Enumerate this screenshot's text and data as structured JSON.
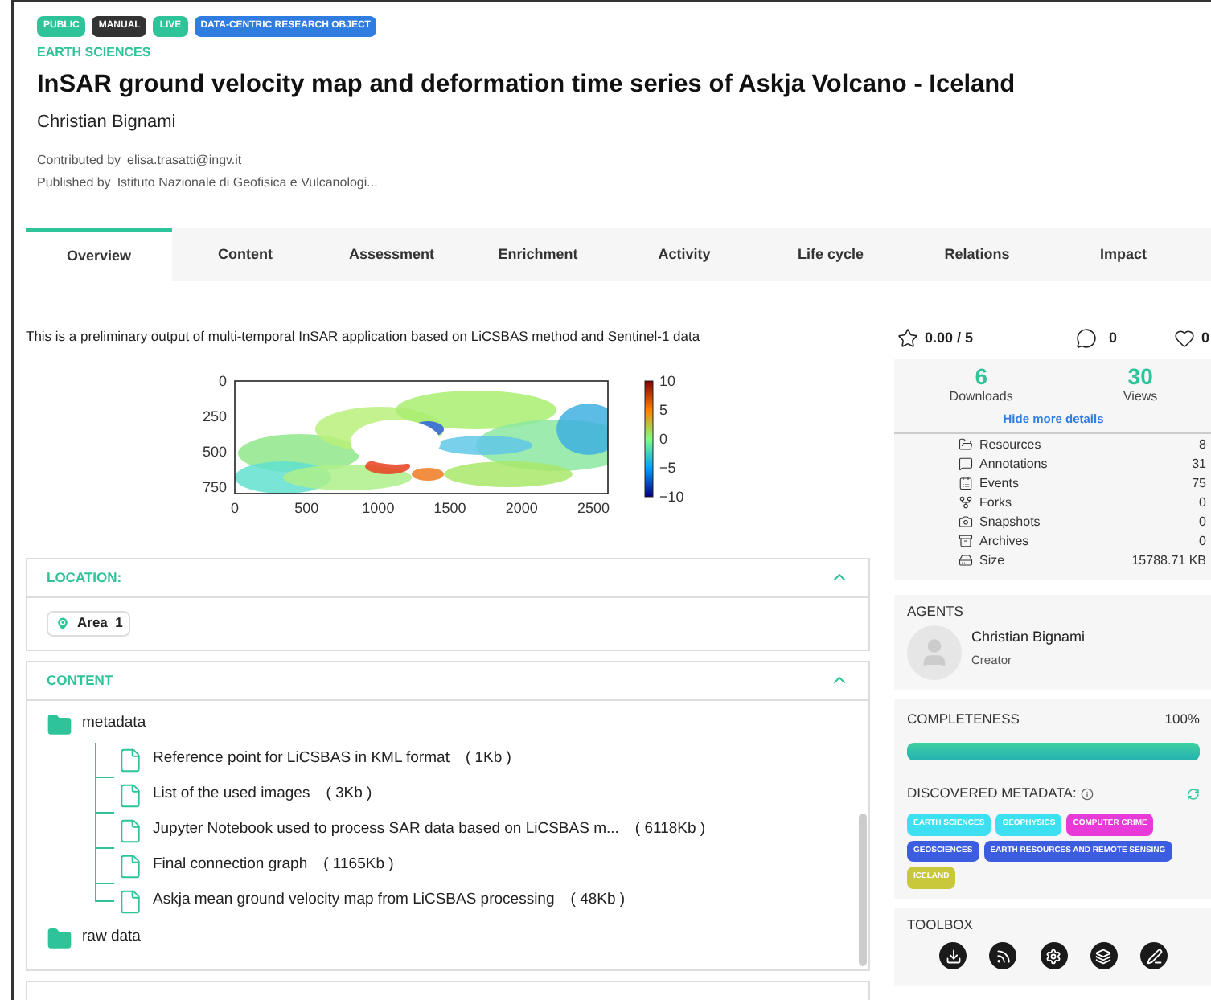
{
  "badges": [
    {
      "label": "PUBLIC",
      "color": "#2fc39a"
    },
    {
      "label": "MANUAL",
      "color": "#333333"
    },
    {
      "label": "LIVE",
      "color": "#2fc39a"
    },
    {
      "label": "DATA-CENTRIC RESEARCH OBJECT",
      "color": "#2f7de0"
    }
  ],
  "category": "EARTH SCIENCES",
  "title": "InSAR ground velocity map and deformation time series of Askja Volcano - Iceland",
  "author": "Christian Bignami",
  "contributed": {
    "label": "Contributed by",
    "value": "elisa.trasatti@ingv.it"
  },
  "published": {
    "label": "Published by",
    "value": "Istituto Nazionale di Geofisica e Vulcanologi..."
  },
  "tabs": [
    {
      "label": "Overview",
      "selected": true
    },
    {
      "label": "Content",
      "selected": false
    },
    {
      "label": "Assessment",
      "selected": false
    },
    {
      "label": "Enrichment",
      "selected": false
    },
    {
      "label": "Activity",
      "selected": false
    },
    {
      "label": "Life cycle",
      "selected": false
    },
    {
      "label": "Relations",
      "selected": false
    },
    {
      "label": "Impact",
      "selected": false
    }
  ],
  "description": "This is a preliminary output of multi-temporal InSAR application based on LiCSBAS method and Sentinel-1 data",
  "figure": {
    "yticks": [
      "0",
      "250",
      "500",
      "750"
    ],
    "xticks": [
      "0",
      "500",
      "1000",
      "1500",
      "2000",
      "2500"
    ],
    "colorbar_ticks": [
      "10",
      "5",
      "0",
      "−5",
      "−10"
    ]
  },
  "location": {
    "title": "LOCATION:",
    "expanded": true,
    "areas": [
      "Area  1"
    ]
  },
  "content": {
    "title": "CONTENT",
    "expanded": true,
    "tree": [
      {
        "name": "metadata",
        "kind": "folder",
        "expanded": true,
        "children": [
          {
            "name": "Reference point for LiCSBAS in KML format",
            "size": "( 1Kb )",
            "kind": "file"
          },
          {
            "name": "List of the used images",
            "size": "( 3Kb )",
            "kind": "file"
          },
          {
            "name": "Jupyter Notebook used to process SAR data based on LiCSBAS m...",
            "size": "( 6118Kb )",
            "kind": "file"
          },
          {
            "name": "Final connection graph",
            "size": "( 1165Kb )",
            "kind": "file"
          },
          {
            "name": "Askja mean ground velocity map from LiCSBAS processing",
            "size": "( 48Kb )",
            "kind": "file"
          }
        ]
      },
      {
        "name": "raw data",
        "kind": "folder",
        "expanded": false
      }
    ]
  },
  "rating": "0.00 / 5",
  "comments": "0",
  "likes": "0",
  "downloads": {
    "value": "6",
    "label": "Downloads"
  },
  "views": {
    "value": "30",
    "label": "Views"
  },
  "details_toggle": "Hide more details",
  "stats": [
    {
      "label": "Resources",
      "value": "8"
    },
    {
      "label": "Annotations",
      "value": "31"
    },
    {
      "label": "Events",
      "value": "75"
    },
    {
      "label": "Forks",
      "value": "0"
    },
    {
      "label": "Snapshots",
      "value": "0"
    },
    {
      "label": "Archives",
      "value": "0"
    },
    {
      "label": "Size",
      "value": "15788.71 KB"
    }
  ],
  "agents": {
    "title": "AGENTS",
    "items": [
      {
        "name": "Christian Bignami",
        "role": "Creator"
      }
    ]
  },
  "completeness": {
    "title": "COMPLETENESS",
    "value": "100%",
    "level": 1
  },
  "discovered": {
    "title": "DISCOVERED METADATA:",
    "tags": [
      {
        "label": "EARTH SCIENCES",
        "color": "#3de0f0"
      },
      {
        "label": "GEOPHYSICS",
        "color": "#3de0f0"
      },
      {
        "label": "COMPUTER CRIME",
        "color": "#e83ad8"
      },
      {
        "label": "GEOSCIENCES",
        "color": "#3d5de0"
      },
      {
        "label": "EARTH RESOURCES AND REMOTE SENSING",
        "color": "#3d5de0"
      },
      {
        "label": "ICELAND",
        "color": "#c8c83a"
      }
    ]
  },
  "toolbox": {
    "title": "TOOLBOX"
  }
}
